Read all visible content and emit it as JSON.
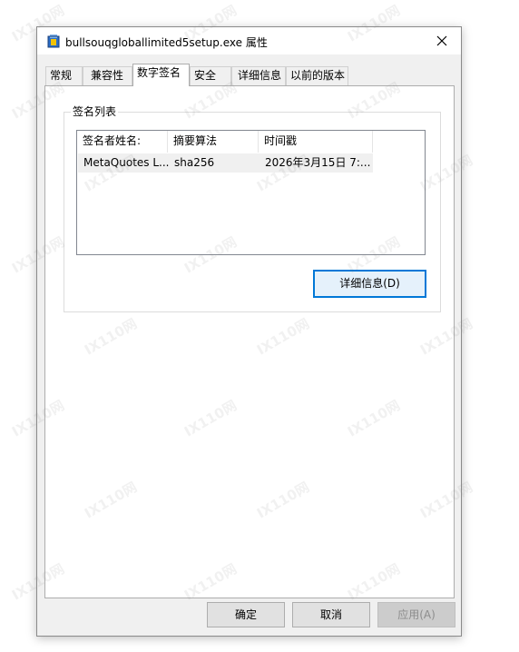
{
  "window": {
    "title": "bullsouqgloballimited5setup.exe 属性",
    "icon": "installer-app-icon",
    "close_icon": "close-icon"
  },
  "tabs": [
    {
      "label": "常规",
      "active": false
    },
    {
      "label": "兼容性",
      "active": false
    },
    {
      "label": "数字签名",
      "active": true
    },
    {
      "label": "安全",
      "active": false
    },
    {
      "label": "详细信息",
      "active": false
    },
    {
      "label": "以前的版本",
      "active": false
    }
  ],
  "signature_list": {
    "group_label": "签名列表",
    "columns": [
      "签名者姓名:",
      "摘要算法",
      "时间戳"
    ],
    "rows": [
      [
        "MetaQuotes L...",
        "sha256",
        "2026年3月15日 7:..."
      ]
    ]
  },
  "details_button": "详细信息(D)",
  "footer": {
    "ok": "确定",
    "cancel": "取消",
    "apply": "应用(A)"
  },
  "watermark": "IX110网",
  "colors": {
    "accent": "#0078d7",
    "window_bg": "#f0f0f0",
    "panel_bg": "#ffffff"
  }
}
